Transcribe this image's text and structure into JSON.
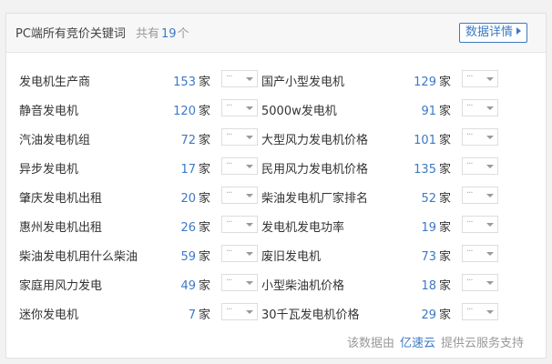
{
  "panel": {
    "title": "PC端所有竞价关键词",
    "count_prefix": "共有",
    "count_value": "19",
    "count_suffix": "个",
    "detail_button": "数据详情"
  },
  "rows": [
    {
      "left": {
        "keyword": "发电机生产商",
        "count": "153",
        "unit": "家",
        "select": "···"
      },
      "right": {
        "keyword": "国产小型发电机",
        "count": "129",
        "unit": "家",
        "select": "···"
      }
    },
    {
      "left": {
        "keyword": "静音发电机",
        "count": "120",
        "unit": "家",
        "select": "···"
      },
      "right": {
        "keyword": "5000w发电机",
        "count": "91",
        "unit": "家",
        "select": "···"
      }
    },
    {
      "left": {
        "keyword": "汽油发电机组",
        "count": "72",
        "unit": "家",
        "select": "···"
      },
      "right": {
        "keyword": "大型风力发电机价格",
        "count": "101",
        "unit": "家",
        "select": "···"
      }
    },
    {
      "left": {
        "keyword": "异步发电机",
        "count": "17",
        "unit": "家",
        "select": "···"
      },
      "right": {
        "keyword": "民用风力发电机价格",
        "count": "135",
        "unit": "家",
        "select": "···"
      }
    },
    {
      "left": {
        "keyword": "肇庆发电机出租",
        "count": "20",
        "unit": "家",
        "select": "···"
      },
      "right": {
        "keyword": "柴油发电机厂家排名",
        "count": "52",
        "unit": "家",
        "select": "···"
      }
    },
    {
      "left": {
        "keyword": "惠州发电机出租",
        "count": "26",
        "unit": "家",
        "select": "···"
      },
      "right": {
        "keyword": "发电机发电功率",
        "count": "19",
        "unit": "家",
        "select": "···"
      }
    },
    {
      "left": {
        "keyword": "柴油发电机用什么柴油",
        "count": "59",
        "unit": "家",
        "select": "···"
      },
      "right": {
        "keyword": "废旧发电机",
        "count": "73",
        "unit": "家",
        "select": "···"
      }
    },
    {
      "left": {
        "keyword": "家庭用风力发电",
        "count": "49",
        "unit": "家",
        "select": "···"
      },
      "right": {
        "keyword": "小型柴油机价格",
        "count": "18",
        "unit": "家",
        "select": "···"
      }
    },
    {
      "left": {
        "keyword": "迷你发电机",
        "count": "7",
        "unit": "家",
        "select": "···"
      },
      "right": {
        "keyword": "30千瓦发电机价格",
        "count": "29",
        "unit": "家",
        "select": "···"
      }
    }
  ],
  "footer": {
    "prefix": "该数据由",
    "brand": "亿速云",
    "suffix": "提供云服务支持"
  },
  "colors": {
    "accent": "#3c79c6",
    "muted": "#999999",
    "text": "#333333"
  }
}
